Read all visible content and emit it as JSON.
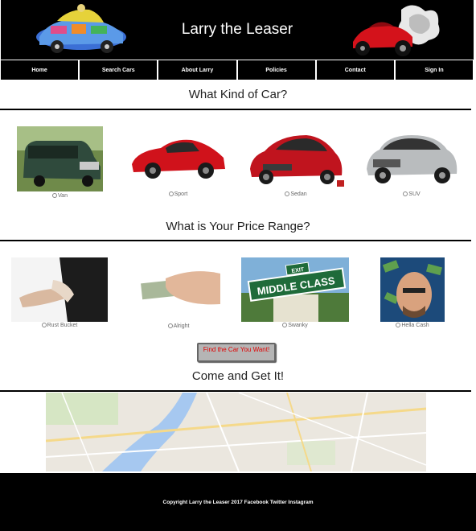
{
  "header": {
    "title": "Larry the Leaser"
  },
  "nav": [
    {
      "label": "Home"
    },
    {
      "label": "Search Cars"
    },
    {
      "label": "About Larry"
    },
    {
      "label": "Policies"
    },
    {
      "label": "Contact"
    },
    {
      "label": "Sign In"
    }
  ],
  "car_section": {
    "title": "What Kind of Car?",
    "cards": [
      {
        "label": "Van",
        "color": "#2f4a3c"
      },
      {
        "label": "Sport",
        "color": "#d0121b"
      },
      {
        "label": "Sedan",
        "color": "#c0141e"
      },
      {
        "label": "SUV",
        "color": "#b9bcbe"
      }
    ]
  },
  "price_section": {
    "title": "What is Your Price Range?",
    "cards": [
      {
        "label": "Rust Bucket"
      },
      {
        "label": "Alright"
      },
      {
        "label": "Swanky",
        "sign_text": "MIDDLE CLASS",
        "sign_top": "EXIT"
      },
      {
        "label": "Hella Cash"
      }
    ]
  },
  "cta": {
    "label": "Find the Car You Want!"
  },
  "map_section": {
    "title": "Come and Get It!"
  },
  "footer": {
    "text": "Copyright Larry the Leaser 2017 Facebook Twitter Instagram"
  }
}
